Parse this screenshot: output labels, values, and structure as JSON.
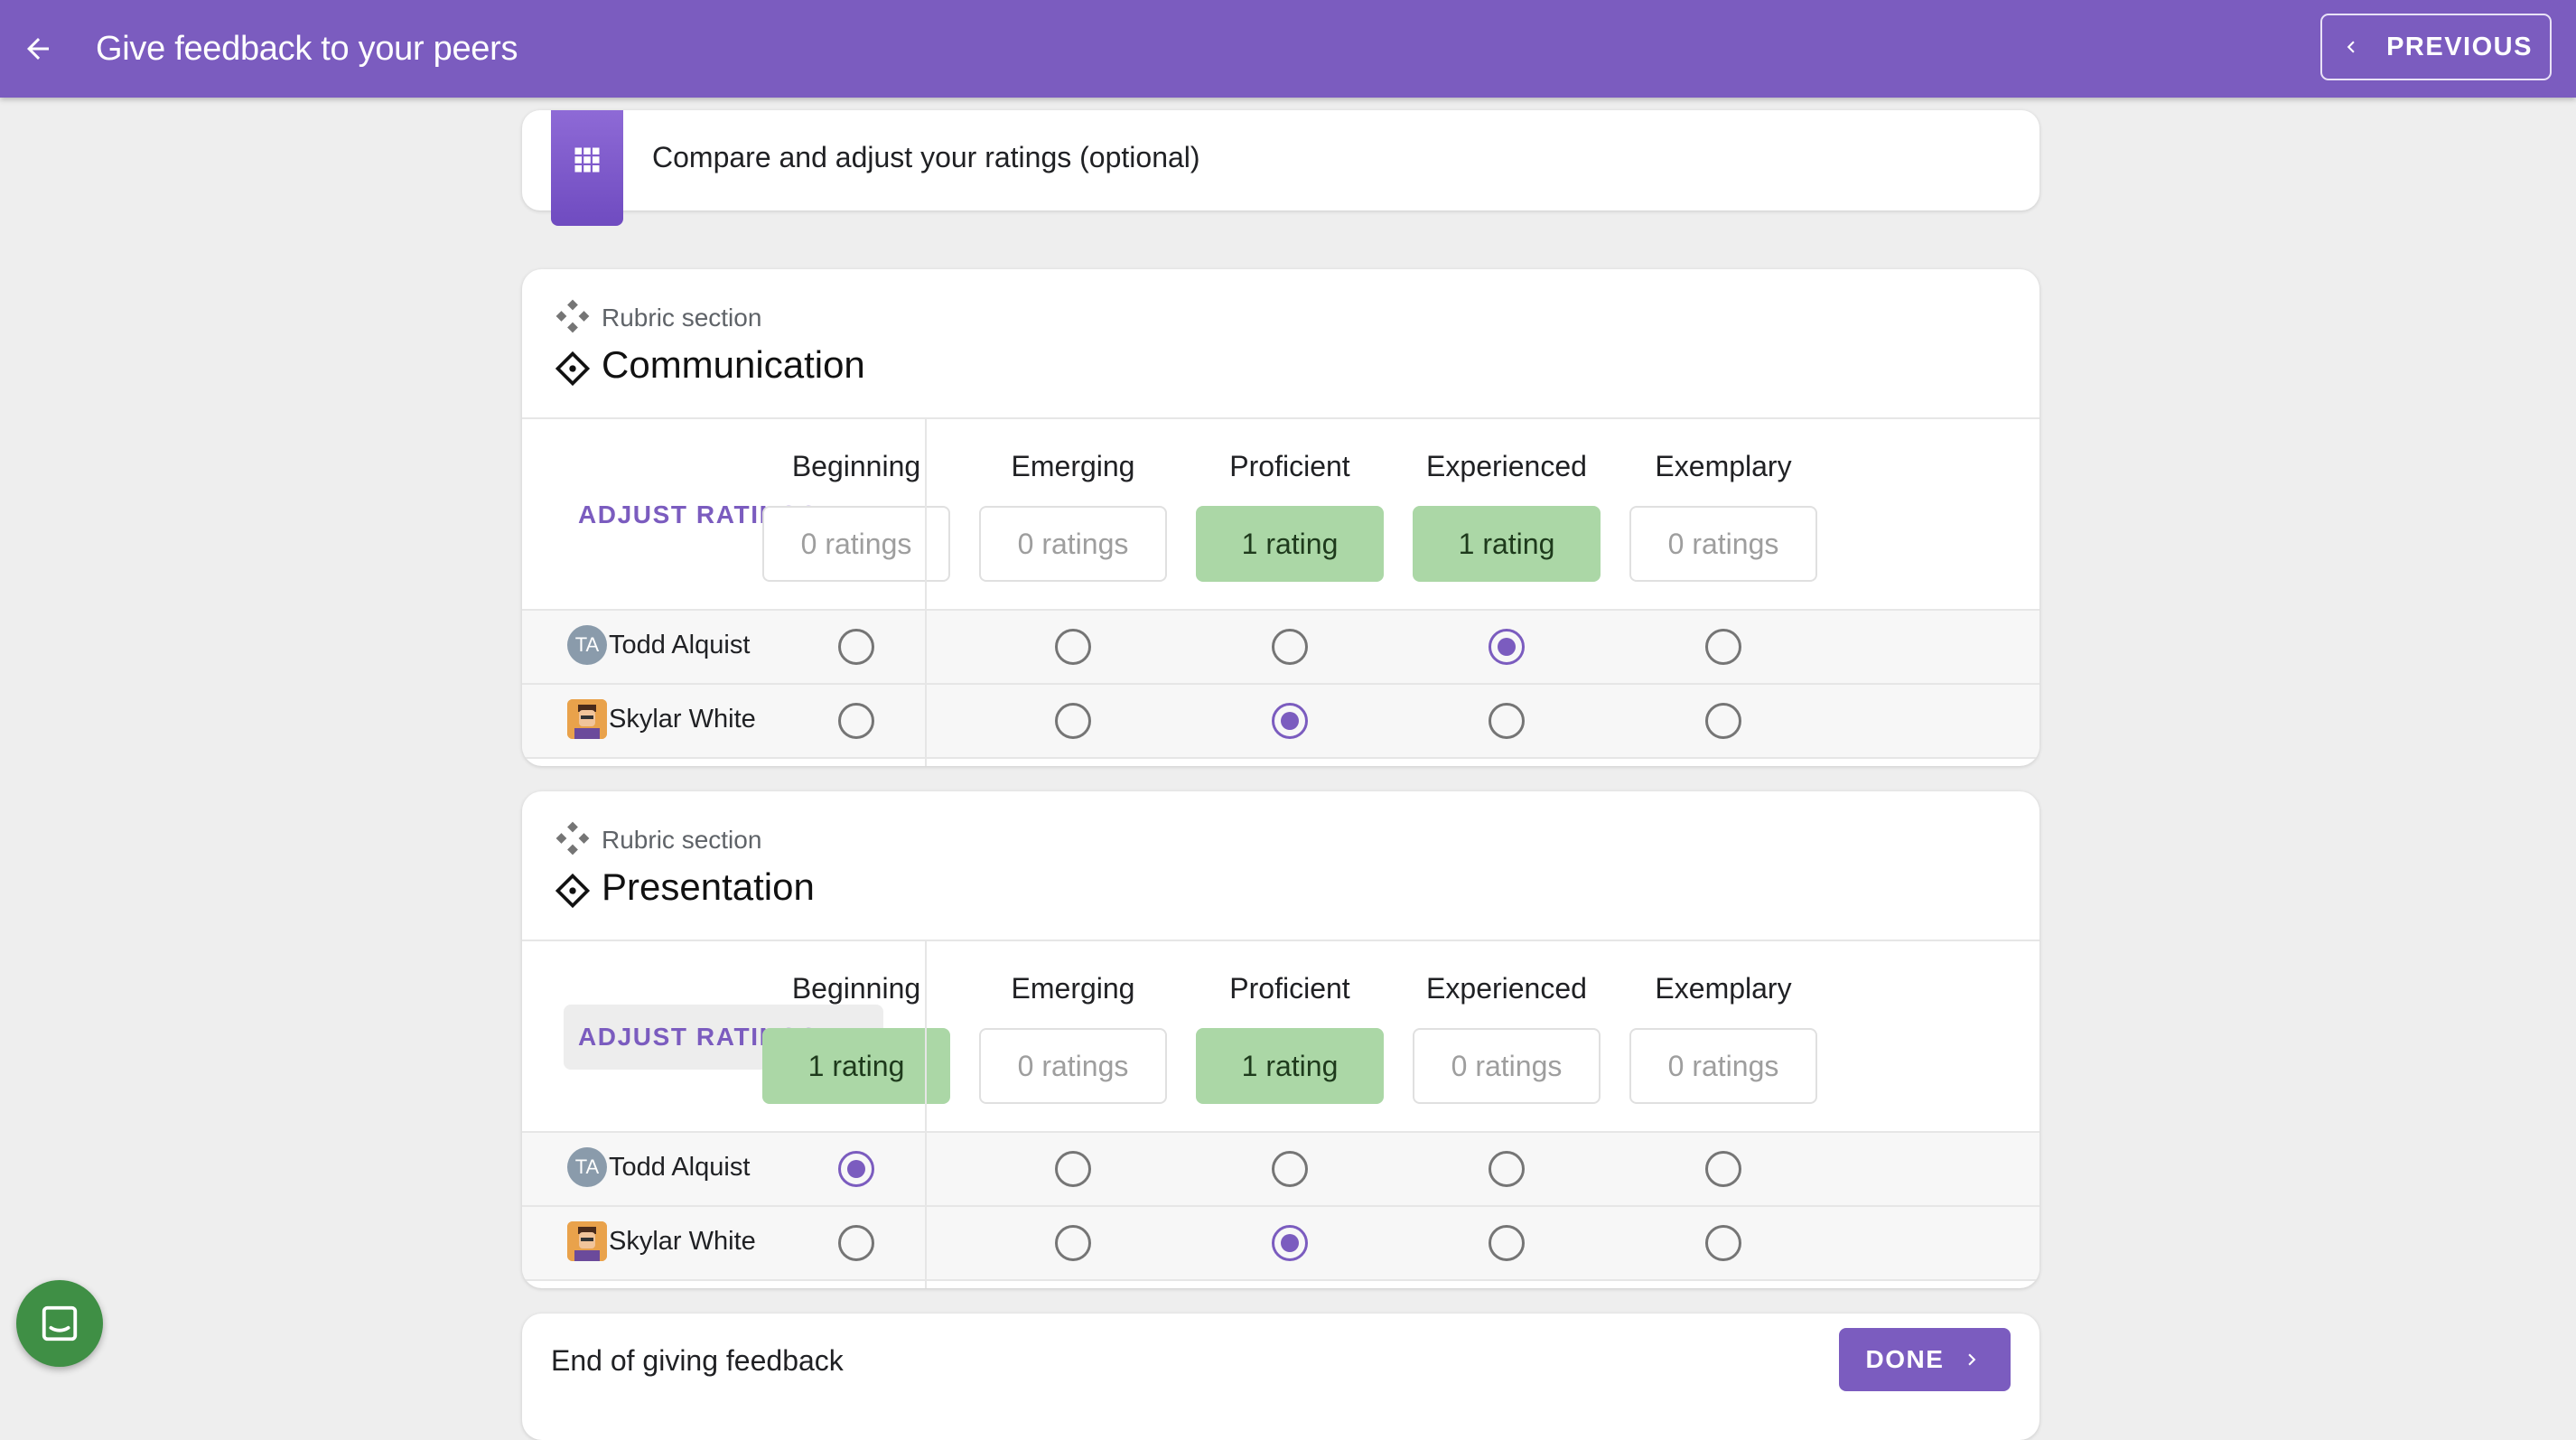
{
  "header": {
    "title": "Give feedback to your peers",
    "previous_label": "PREVIOUS"
  },
  "banner": {
    "text": "Compare and adjust your ratings (optional)"
  },
  "sections": [
    {
      "label": "Rubric section",
      "title": "Communication",
      "adjust_label": "ADJUST RATINGS",
      "levels": [
        {
          "name": "Beginning",
          "count": "0 ratings",
          "has_ratings": false
        },
        {
          "name": "Emerging",
          "count": "0 ratings",
          "has_ratings": false
        },
        {
          "name": "Proficient",
          "count": "1 rating",
          "has_ratings": true
        },
        {
          "name": "Experienced",
          "count": "1 rating",
          "has_ratings": true
        },
        {
          "name": "Exemplary",
          "count": "0 ratings",
          "has_ratings": false
        }
      ],
      "rows": [
        {
          "initials": "TA",
          "name": "Todd Alquist",
          "selected": 3
        },
        {
          "initials": "",
          "name": "Skylar White",
          "selected": 2
        }
      ]
    },
    {
      "label": "Rubric section",
      "title": "Presentation",
      "adjust_label": "ADJUST RATINGS",
      "levels": [
        {
          "name": "Beginning",
          "count": "1 rating",
          "has_ratings": true
        },
        {
          "name": "Emerging",
          "count": "0 ratings",
          "has_ratings": false
        },
        {
          "name": "Proficient",
          "count": "1 rating",
          "has_ratings": true
        },
        {
          "name": "Experienced",
          "count": "0 ratings",
          "has_ratings": false
        },
        {
          "name": "Exemplary",
          "count": "0 ratings",
          "has_ratings": false
        }
      ],
      "rows": [
        {
          "initials": "TA",
          "name": "Todd Alquist",
          "selected": 0
        },
        {
          "initials": "",
          "name": "Skylar White",
          "selected": 2
        }
      ]
    }
  ],
  "footer": {
    "text": "End of giving feedback",
    "done_label": "DONE"
  },
  "icons": {
    "back": "arrow-left-icon",
    "previous": "chevron-left-icon",
    "banner": "grid-icon",
    "section_label": "diamond-cluster-icon",
    "section_title": "diamond-icon",
    "adjust": "chevron-up-icon",
    "done": "chevron-right-icon",
    "chat": "chat-icon"
  },
  "colors": {
    "primary": "#7b5cbf",
    "rating_fill": "#abd7a6",
    "chat": "#3f8f45"
  }
}
